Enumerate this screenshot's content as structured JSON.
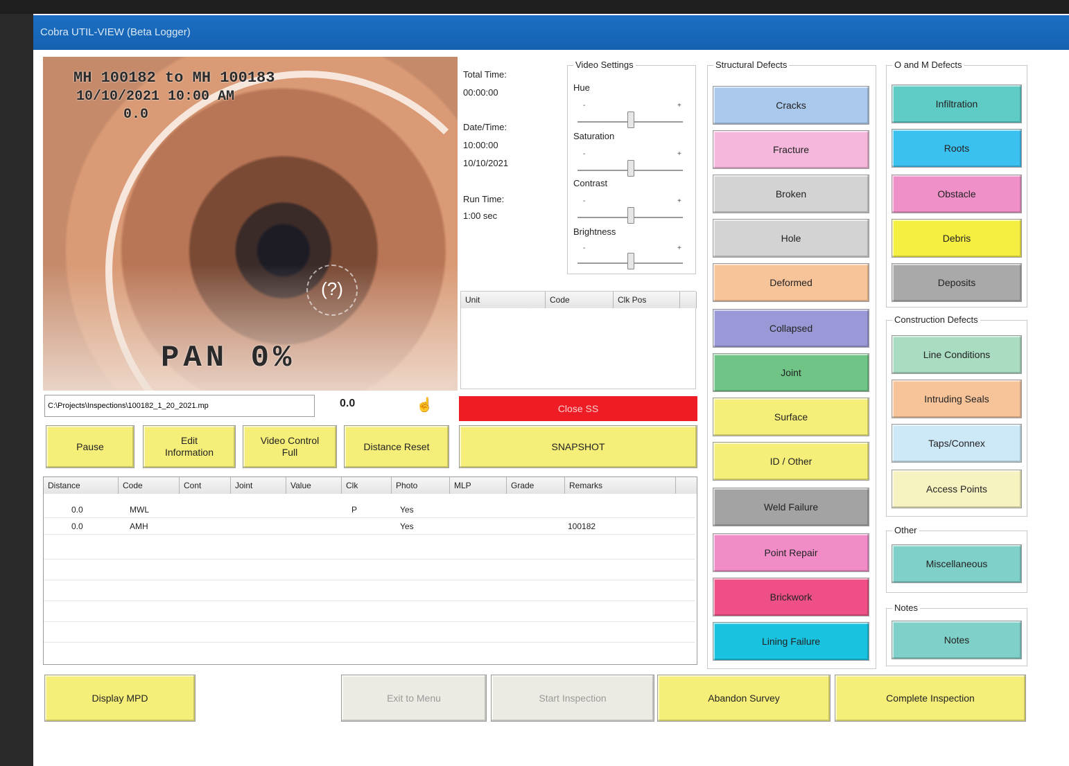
{
  "window": {
    "title": "Cobra UTIL-VIEW (Beta Logger)"
  },
  "video": {
    "overlay_line1": "MH 100182 to MH 100183",
    "overlay_line2": "10/10/2021   10:00 AM",
    "overlay_line3": "0.0",
    "overlay_bottom": "PAN 0%",
    "lumen_mark": "(?)"
  },
  "info_panel": {
    "total_time_label": "Total Time:",
    "total_time_value": "00:00:00",
    "date_time_label": "Date/Time:",
    "date_time_value1": "10:00:00",
    "date_time_value2": "10/10/2021",
    "run_time_label": "Run Time:",
    "run_time_value": "1:00 sec"
  },
  "video_settings": {
    "title": "Video Settings",
    "sliders": [
      {
        "label": "Hue",
        "min": "-",
        "max": "+",
        "level": 0.5
      },
      {
        "label": "Saturation",
        "min": "-",
        "max": "+",
        "level": 0.5
      },
      {
        "label": "Contrast",
        "min": "-",
        "max": "+",
        "level": 0.5
      },
      {
        "label": "Brightness",
        "min": "-",
        "max": "+",
        "level": 0.5
      }
    ]
  },
  "code_list": {
    "headers": [
      "Unit",
      "Code",
      "Clk Pos"
    ]
  },
  "file_bar": {
    "path": "C:\\Projects\\Inspections\\100182_1_20_2021.mp",
    "distance": "0.0",
    "ptr_icon": "pointer"
  },
  "status": {
    "close_ss_label": "Close SS"
  },
  "controls": {
    "pause": "Pause",
    "edit_line1": "Edit",
    "edit_line2": "Information",
    "video_control_line1": "Video Control",
    "video_control_line2": "Full",
    "distance_reset": "Distance Reset",
    "snapshot": "SNAPSHOT"
  },
  "obs_table": {
    "headers": [
      "Distance",
      "Code",
      "Cont",
      "Joint",
      "Value",
      "Clk",
      "Photo",
      "MLP",
      "Grade",
      "Remarks"
    ],
    "rows": [
      {
        "distance": "0.0",
        "code": "MWL",
        "clk": "P",
        "photo": "Yes",
        "remarks": ""
      },
      {
        "distance": "0.0",
        "code": "AMH",
        "clk": "",
        "photo": "Yes",
        "remarks": "100182"
      }
    ]
  },
  "structural": {
    "title": "Structural Defects",
    "buttons": [
      {
        "label": "Cracks",
        "color": "#a9c8ec"
      },
      {
        "label": "Fracture",
        "color": "#f5b7dc"
      },
      {
        "label": "Broken",
        "color": "#d3d3d3"
      },
      {
        "label": "Hole",
        "color": "#d3d3d3"
      },
      {
        "label": "Deformed",
        "color": "#f7c49a"
      },
      {
        "label": "Collapsed",
        "color": "#9a98d6"
      },
      {
        "label": "Joint",
        "color": "#6fc486"
      },
      {
        "label": "Surface",
        "color": "#f5ef79"
      },
      {
        "label": "ID / Other",
        "color": "#f5ef79"
      },
      {
        "label": "Weld Failure",
        "color": "#a3a3a3"
      },
      {
        "label": "Point Repair",
        "color": "#f18cc8"
      },
      {
        "label": "Brickwork",
        "color": "#ee4f86"
      },
      {
        "label": "Lining Failure",
        "color": "#19c3df"
      }
    ]
  },
  "om_defects": {
    "title": "O and M Defects",
    "buttons": [
      {
        "label": "Infiltration",
        "color": "#5fcbc5"
      },
      {
        "label": "Roots",
        "color": "#3bc1f0"
      },
      {
        "label": "Obstacle",
        "color": "#ef90c8"
      },
      {
        "label": "Debris",
        "color": "#f5ef42"
      },
      {
        "label": "Deposits",
        "color": "#a9a9a9"
      }
    ]
  },
  "construction": {
    "title": "Construction Defects",
    "buttons": [
      {
        "label": "Line Conditions",
        "color": "#a9dcc1"
      },
      {
        "label": "Intruding Seals",
        "color": "#f7c49a"
      },
      {
        "label": "Taps/Connex",
        "color": "#cde8f7"
      },
      {
        "label": "Access Points",
        "color": "#f7f3c0"
      }
    ]
  },
  "other": {
    "title": "Other",
    "button": {
      "label": "Miscellaneous",
      "color": "#7fd0c8"
    }
  },
  "notes": {
    "title": "Notes",
    "button": {
      "label": "Notes",
      "color": "#7fd0c8"
    }
  },
  "bottom": {
    "display_mpd": "Display MPD",
    "exit_menu": "Exit to Menu",
    "start_inspection": "Start Inspection",
    "abandon_survey": "Abandon Survey",
    "complete_inspection": "Complete Inspection"
  }
}
